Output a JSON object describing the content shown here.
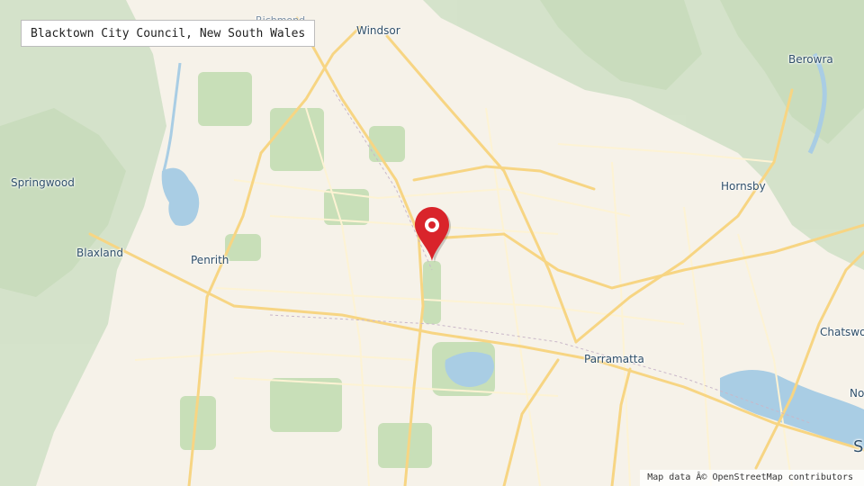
{
  "title": "Blacktown City Council, New South Wales",
  "attribution": "Map data Â© OpenStreetMap contributors",
  "marker": {
    "icon": "location-pin-icon",
    "color": "#d9242b"
  },
  "places": {
    "richmond": "Richmond",
    "windsor": "Windsor",
    "berowra": "Berowra",
    "springwood": "Springwood",
    "hornsby": "Hornsby",
    "blaxland": "Blaxland",
    "penrith": "Penrith",
    "chatswood": "Chatswo",
    "parramatta": "Parramatta",
    "north_sydney": "No",
    "sydney": "S"
  },
  "colors": {
    "land": "#f6f2e9",
    "forest": "#cfe0c5",
    "park": "#c8dfb8",
    "water": "#a9cde4",
    "major_road": "#f7d583",
    "minor_road": "#fdf3d4"
  }
}
